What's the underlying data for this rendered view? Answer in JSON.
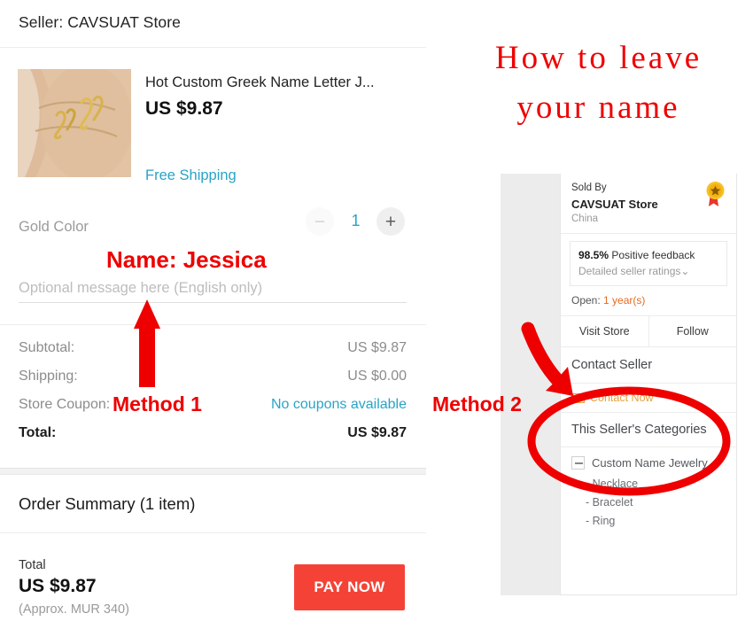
{
  "checkout": {
    "seller_header": "Seller: CAVSUAT Store",
    "product": {
      "title": "Hot Custom Greek Name Letter J...",
      "price": "US $9.87",
      "shipping_label": "Free Shipping",
      "variant": "Gold Color",
      "qty_minus": "−",
      "qty_value": "1",
      "qty_plus": "+"
    },
    "message_input": {
      "placeholder": "Optional message here (English only)",
      "value": ""
    },
    "totals": [
      {
        "label": "Subtotal:",
        "value": "US $9.87",
        "link": false
      },
      {
        "label": "Shipping:",
        "value": "US $0.00",
        "link": false
      },
      {
        "label": "Store Coupon:",
        "value": "No coupons available",
        "link": true
      },
      {
        "label": "Total:",
        "value": "US $9.87",
        "link": false
      }
    ],
    "order_summary_title": "Order Summary (1 item)",
    "pay": {
      "total_label": "Total",
      "total_value": "US $9.87",
      "approx": "(Approx. MUR 340)",
      "button": "PAY NOW"
    }
  },
  "annotations": {
    "title_line1": "How to leave",
    "title_line2": "your name",
    "name_label": "Name: Jessica",
    "method1": "Method 1",
    "method2": "Method 2",
    "accent_color": "#ee0000"
  },
  "seller_card": {
    "sold_by_label": "Sold By",
    "store_name": "CAVSUAT Store",
    "country": "China",
    "feedback_percent": "98.5%",
    "feedback_label": "Positive feedback",
    "detailed_ratings": "Detailed seller ratings",
    "open_label": "Open:",
    "open_value": "1 year(s)",
    "visit_store": "Visit Store",
    "follow": "Follow",
    "contact_seller": "Contact Seller",
    "contact_now": "Contact Now",
    "categories_header": "This Seller's Categories",
    "category_root": "Custom Name Jewelry",
    "category_children": [
      "- Necklace",
      "- Bracelet",
      "- Ring"
    ]
  },
  "colors": {
    "accent_red": "#f44336",
    "link_blue": "#2aa3c7",
    "gold": "#e6a03c",
    "orange": "#e66a1f"
  }
}
